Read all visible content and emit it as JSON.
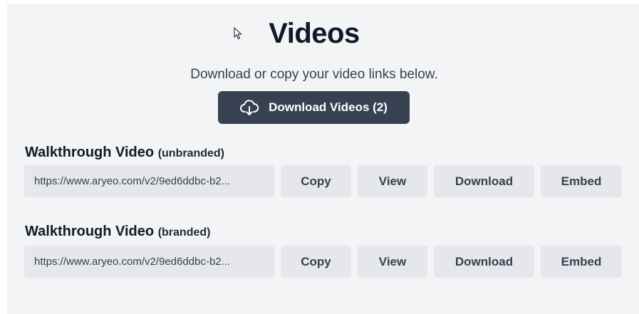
{
  "header": {
    "title": "Videos",
    "subtitle": "Download or copy your video links below.",
    "download_all_label": "Download Videos (2)"
  },
  "videos": [
    {
      "title": "Walkthrough Video",
      "variant": "(unbranded)",
      "url": "https://www.aryeo.com/v2/9ed6ddbc-b2...",
      "copy_label": "Copy",
      "view_label": "View",
      "download_label": "Download",
      "embed_label": "Embed"
    },
    {
      "title": "Walkthrough Video",
      "variant": "(branded)",
      "url": "https://www.aryeo.com/v2/9ed6ddbc-b2...",
      "copy_label": "Copy",
      "view_label": "View",
      "download_label": "Download",
      "embed_label": "Embed"
    }
  ],
  "colors": {
    "primary_button": "#374151",
    "secondary_button": "#e5e7eb",
    "panel_background": "#f3f4f6"
  },
  "icons": {
    "download_all": "cloud-download-icon",
    "cursor": "mouse-pointer-icon"
  }
}
